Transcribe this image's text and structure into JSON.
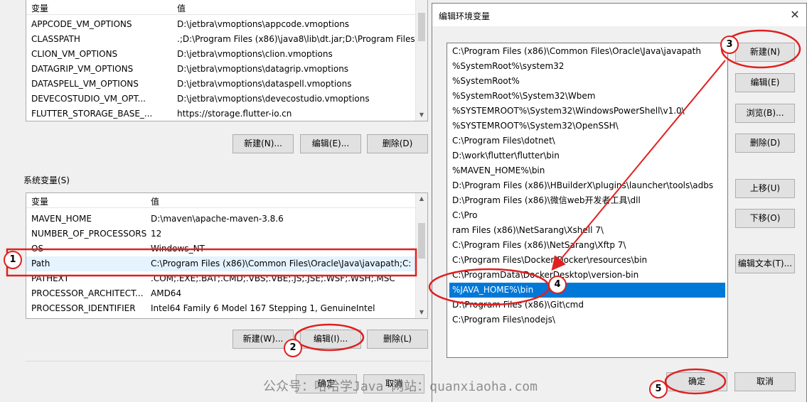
{
  "user_vars": {
    "headers": {
      "name": "变量",
      "value": "值"
    },
    "rows": [
      {
        "name": "APPCODE_VM_OPTIONS",
        "value": "D:\\jetbra\\vmoptions\\appcode.vmoptions"
      },
      {
        "name": "CLASSPATH",
        "value": ".;D:\\Program Files (x86)\\java8\\lib\\dt.jar;D:\\Program Files (x86)..."
      },
      {
        "name": "CLION_VM_OPTIONS",
        "value": "D:\\jetbra\\vmoptions\\clion.vmoptions"
      },
      {
        "name": "DATAGRIP_VM_OPTIONS",
        "value": "D:\\jetbra\\vmoptions\\datagrip.vmoptions"
      },
      {
        "name": "DATASPELL_VM_OPTIONS",
        "value": "D:\\jetbra\\vmoptions\\dataspell.vmoptions"
      },
      {
        "name": "DEVECOSTUDIO_VM_OPT...",
        "value": "D:\\jetbra\\vmoptions\\devecostudio.vmoptions"
      },
      {
        "name": "FLUTTER_STORAGE_BASE_...",
        "value": "https://storage.flutter-io.cn"
      }
    ],
    "buttons": {
      "new": "新建(N)...",
      "edit": "编辑(E)...",
      "delete": "删除(D)"
    }
  },
  "system_vars": {
    "group_label": "系统变量(S)",
    "headers": {
      "name": "变量",
      "value": "值"
    },
    "rows": [
      {
        "name": "MAVEN_HOME",
        "value": "D:\\maven\\apache-maven-3.8.6"
      },
      {
        "name": "NUMBER_OF_PROCESSORS",
        "value": "12"
      },
      {
        "name": "OS",
        "value": "Windows_NT"
      },
      {
        "name": "Path",
        "value": "C:\\Program Files (x86)\\Common Files\\Oracle\\Java\\javapath;C:..."
      },
      {
        "name": "PATHEXT",
        "value": ".COM;.EXE;.BAT;.CMD;.VBS;.VBE;.JS;.JSE;.WSF;.WSH;.MSC"
      },
      {
        "name": "PROCESSOR_ARCHITECT...",
        "value": "AMD64"
      },
      {
        "name": "PROCESSOR_IDENTIFIER",
        "value": "Intel64 Family 6 Model 167 Stepping 1, GenuineIntel"
      }
    ],
    "buttons": {
      "new": "新建(W)...",
      "edit": "编辑(I)...",
      "delete": "删除(L)"
    }
  },
  "left_footer": {
    "ok": "确定",
    "cancel": "取消"
  },
  "dialog": {
    "title": "编辑环境变量",
    "close_icon": "close-icon",
    "paths": [
      "C:\\Program Files (x86)\\Common Files\\Oracle\\Java\\javapath",
      "%SystemRoot%\\system32",
      "%SystemRoot%",
      "%SystemRoot%\\System32\\Wbem",
      "%SYSTEMROOT%\\System32\\WindowsPowerShell\\v1.0\\",
      "%SYSTEMROOT%\\System32\\OpenSSH\\",
      "C:\\Program Files\\dotnet\\",
      "D:\\work\\flutter\\flutter\\bin",
      "%MAVEN_HOME%\\bin",
      "D:\\Program Files (x86)\\HBuilderX\\plugins\\launcher\\tools\\adbs",
      "D:\\Program Files (x86)\\微信web开发者工具\\dll",
      "C:\\Pro",
      "ram Files (x86)\\NetSarang\\Xshell 7\\",
      "C:\\Program Files (x86)\\NetSarang\\Xftp 7\\",
      "C:\\Program Files\\Docker\\Docker\\resources\\bin",
      "C:\\ProgramData\\DockerDesktop\\version-bin",
      "%JAVA_HOME%\\bin",
      "D:\\Program Files (x86)\\Git\\cmd",
      "C:\\Program Files\\nodejs\\"
    ],
    "selected_index": 16,
    "buttons": {
      "new": "新建(N)",
      "edit": "编辑(E)",
      "browse": "浏览(B)...",
      "delete": "删除(D)",
      "move_up": "上移(U)",
      "move_down": "下移(O)",
      "edit_text": "编辑文本(T)...",
      "ok": "确定",
      "cancel": "取消"
    }
  },
  "annotations": {
    "badges": [
      "1",
      "2",
      "3",
      "4",
      "5"
    ],
    "color": "#e02020"
  },
  "watermark": "公众号：哈哈学Java 网站：quanxiaoha.com"
}
